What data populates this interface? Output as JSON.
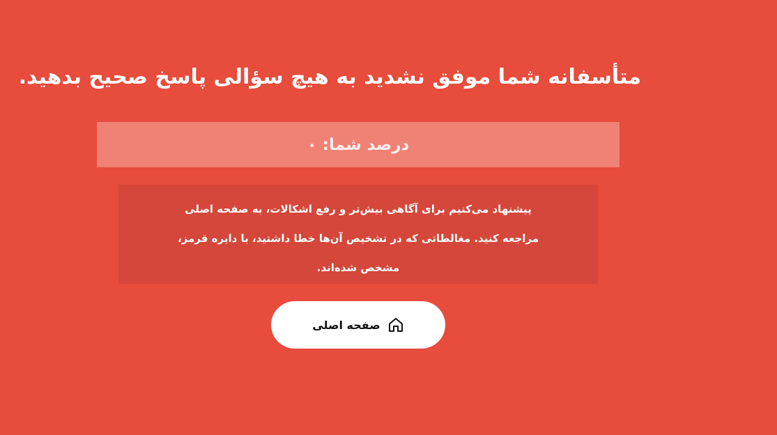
{
  "result": {
    "headline": "متأسفانه شما موفق نشدید به هیچ سؤالی پاسخ صحیح بدهید.",
    "score_text": "درصد شما: ۰",
    "suggestion": "پیشنهاد می‌کنیم برای آگاهی بیش‌تر و رفع اشکالات، به صفحه اصلی مراجعه کنید. مغالطاتی که در تشخیص آن‌ها خطا داشتید، با دایره قرمز، مشخص شده‌اند."
  },
  "actions": {
    "home_label": "صفحه اصلی",
    "home_icon": "home-icon"
  },
  "colors": {
    "background": "#e74c3c",
    "score_box": "#ef8274",
    "message_box": "#d4473a",
    "button": "#ffffff"
  }
}
